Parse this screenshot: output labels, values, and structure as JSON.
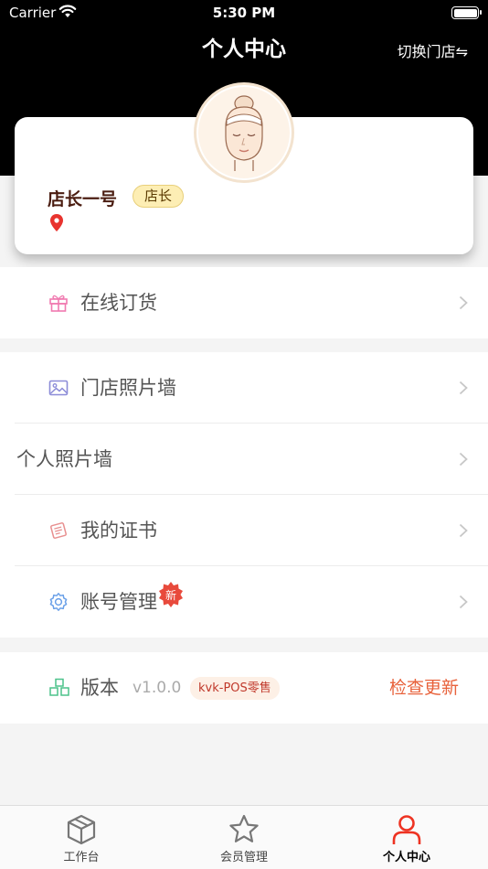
{
  "status_bar": {
    "carrier": "Carrier",
    "time": "5:30 PM"
  },
  "header": {
    "title": "个人中心",
    "switch_store": "切换门店⇋"
  },
  "profile": {
    "name": "店长一号",
    "role": "店长"
  },
  "menu": {
    "online_order": "在线订货",
    "store_photo_wall": "门店照片墙",
    "personal_photo_wall": "个人照片墙",
    "my_certificates": "我的证书",
    "account_management": "账号管理",
    "new_badge": "新"
  },
  "version": {
    "label": "版本",
    "number": "v1.0.0",
    "tag": "kvk-POS零售",
    "check_update": "检查更新"
  },
  "tabs": [
    {
      "label": "工作台",
      "icon": "box-icon"
    },
    {
      "label": "会员管理",
      "icon": "star-icon"
    },
    {
      "label": "个人中心",
      "icon": "person-icon"
    }
  ],
  "colors": {
    "accent": "#e8623b",
    "active_tab": "#ee3322",
    "badge_red": "#e84a3c",
    "role_badge": "#fdeeb4"
  }
}
